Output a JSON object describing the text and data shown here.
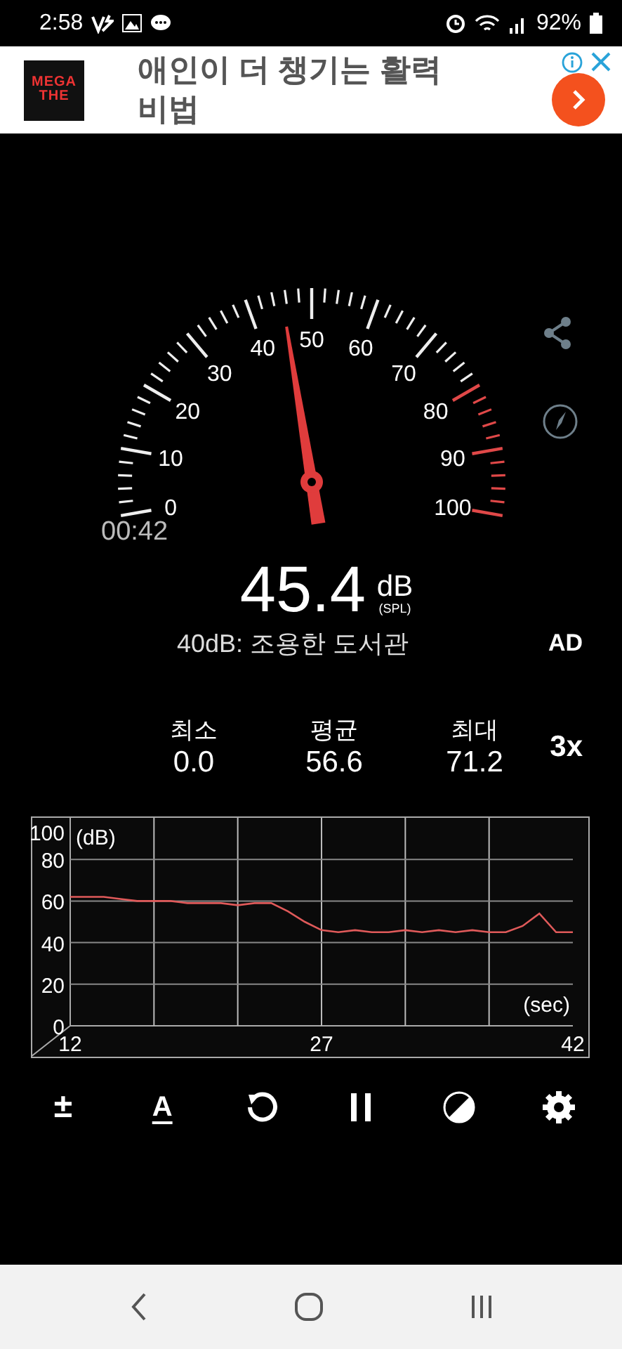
{
  "status_bar": {
    "time": "2:58",
    "battery": "92%"
  },
  "ad": {
    "logo": [
      "MEGA",
      "THE"
    ],
    "text": "애인이 더 챙기는 활력 비법"
  },
  "gauge": {
    "labels": [
      "0",
      "10",
      "20",
      "30",
      "40",
      "50",
      "60",
      "70",
      "80",
      "90",
      "100"
    ],
    "elapsed": "00:42"
  },
  "reading": {
    "value": "45.4",
    "unit": "dB",
    "unit_note": "(SPL)",
    "description": "40dB: 조용한 도서관",
    "weighting": "AD"
  },
  "stats": [
    {
      "label": "최소",
      "value": "0.0"
    },
    {
      "label": "평균",
      "value": "56.6"
    },
    {
      "label": "최대",
      "value": "71.2"
    }
  ],
  "speed": "3x",
  "history": {
    "chart_data": {
      "type": "line",
      "grid": true,
      "ylabel": "(dB)",
      "xlabel": "(sec)",
      "ylim": [
        0,
        100
      ],
      "yticks": [
        0,
        20,
        40,
        60,
        80,
        100
      ],
      "xlim": [
        12,
        42
      ],
      "xticks": [
        12,
        27,
        42
      ],
      "x": [
        12,
        13,
        14,
        15,
        16,
        17,
        18,
        19,
        20,
        21,
        22,
        23,
        24,
        25,
        26,
        27,
        28,
        29,
        30,
        31,
        32,
        33,
        34,
        35,
        36,
        37,
        38,
        39,
        40,
        41,
        42
      ],
      "series": [
        {
          "color": "#e05a5a",
          "values": [
            62,
            62,
            62,
            61,
            60,
            60,
            60,
            59,
            59,
            59,
            58,
            59,
            59,
            55,
            50,
            46,
            45,
            46,
            45,
            45,
            46,
            45,
            46,
            45,
            46,
            45,
            45,
            48,
            54,
            45,
            45
          ]
        }
      ]
    }
  },
  "toolbar": [
    {
      "kind": "text",
      "label": "±"
    },
    {
      "kind": "text",
      "label": "A"
    },
    {
      "kind": "reset"
    },
    {
      "kind": "pause"
    },
    {
      "kind": "contrast"
    },
    {
      "kind": "settings"
    }
  ]
}
